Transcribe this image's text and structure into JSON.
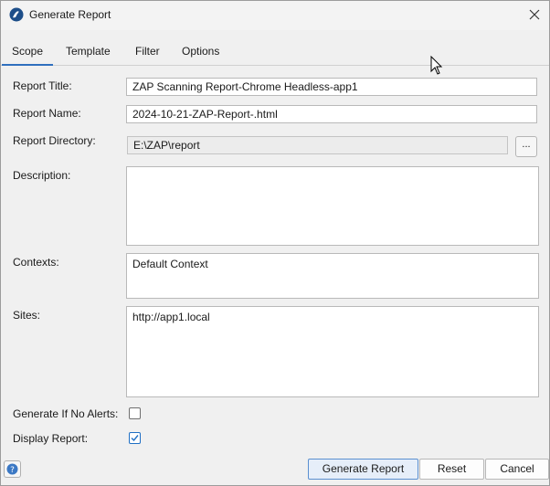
{
  "window": {
    "title": "Generate Report"
  },
  "tabs": [
    {
      "label": "Scope",
      "active": true
    },
    {
      "label": "Template"
    },
    {
      "label": "Filter"
    },
    {
      "label": "Options"
    }
  ],
  "form": {
    "report_title": {
      "label": "Report Title:",
      "value": "ZAP Scanning Report-Chrome Headless-app1"
    },
    "report_name": {
      "label": "Report Name:",
      "value": "2024-10-21-ZAP-Report-.html"
    },
    "report_directory": {
      "label": "Report Directory:",
      "value": "E:\\ZAP\\report",
      "browse_label": "..."
    },
    "description": {
      "label": "Description:",
      "value": ""
    },
    "contexts": {
      "label": "Contexts:",
      "items": [
        "Default Context"
      ]
    },
    "sites": {
      "label": "Sites:",
      "items": [
        "http://app1.local"
      ]
    },
    "generate_if_no_alerts": {
      "label": "Generate If No Alerts:",
      "checked": false
    },
    "display_report": {
      "label": "Display Report:",
      "checked": true
    }
  },
  "buttons": {
    "generate": "Generate Report",
    "reset": "Reset",
    "cancel": "Cancel"
  },
  "icons": {
    "app": "zap-logo-icon",
    "close": "close-icon",
    "help": "help-icon",
    "check": "checkmark-icon",
    "cursor": "mouse-cursor-icon"
  },
  "colors": {
    "accent": "#2f6fbe",
    "primary_button_bg": "#e6eef9",
    "checkmark": "#1f6fc4"
  }
}
